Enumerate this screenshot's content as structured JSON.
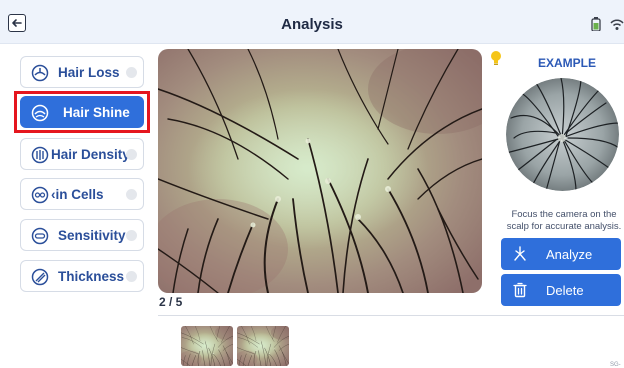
{
  "header": {
    "title": "Analysis",
    "back_icon": "arrow-left-icon",
    "status_icons": [
      "battery-icon",
      "wifi-icon"
    ]
  },
  "menu": {
    "items": [
      {
        "label": "Hair Loss",
        "icon": "hair-loss-icon",
        "selected": false
      },
      {
        "label": "Hair Shine",
        "icon": "hair-shine-icon",
        "selected": true
      },
      {
        "label": "Hair Density",
        "icon": "hair-density-icon",
        "selected": false
      },
      {
        "label": "‹in Cells",
        "icon": "skin-cells-icon",
        "selected": false
      },
      {
        "label": "Sensitivity",
        "icon": "sensitivity-icon",
        "selected": false
      },
      {
        "label": "Thickness",
        "icon": "thickness-icon",
        "selected": false
      }
    ]
  },
  "viewer": {
    "counter": "2 / 5",
    "current_index": 2,
    "total": 5,
    "thumbnails": 2
  },
  "example": {
    "title": "EXAMPLE",
    "hint": "Focus the camera on the scalp for accurate analysis.",
    "bulb_icon": "lightbulb-icon"
  },
  "actions": {
    "analyze_label": "Analyze",
    "delete_label": "Delete"
  },
  "footer": {
    "code": "SG-"
  },
  "colors": {
    "accent": "#2f6fdb",
    "highlight": "#e5161e",
    "menu_text": "#2b4f9a",
    "header_bg": "#eef3fb"
  }
}
